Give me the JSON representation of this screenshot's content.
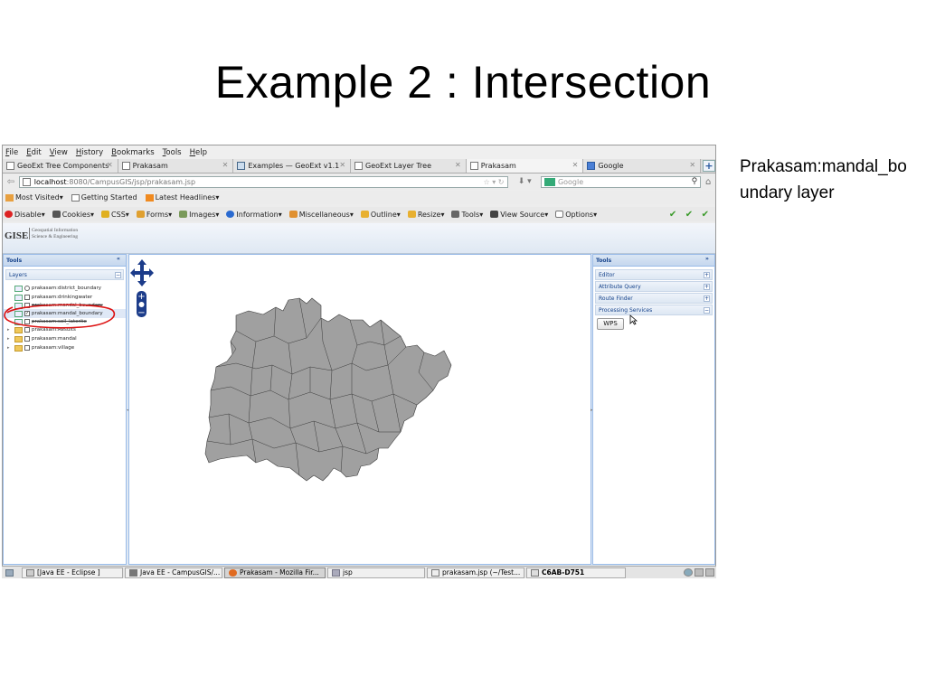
{
  "slide": {
    "title": "Example 2 : Intersection",
    "caption": "Prakasam:mandal_boundary layer"
  },
  "browser": {
    "menu": [
      "File",
      "Edit",
      "View",
      "History",
      "Bookmarks",
      "Tools",
      "Help"
    ],
    "tabs": [
      {
        "label": "GeoExt Tree Components"
      },
      {
        "label": "Prakasam"
      },
      {
        "label": "Examples — GeoExt v1.1"
      },
      {
        "label": "GeoExt Layer Tree"
      },
      {
        "label": "Prakasam"
      },
      {
        "label": "Google"
      }
    ],
    "url": {
      "host": "localhost",
      "path": ":8080/CampusGIS/jsp/prakasam.jsp"
    },
    "search_placeholder": "Google",
    "bookmarks": [
      "Most Visited",
      "Getting Started",
      "Latest Headlines"
    ],
    "devtools": [
      "Disable",
      "Cookies",
      "CSS",
      "Forms",
      "Images",
      "Information",
      "Miscellaneous",
      "Outline",
      "Resize",
      "Tools",
      "View Source",
      "Options"
    ],
    "checks": "✔ ✔ ✔"
  },
  "app": {
    "logo": "GISE",
    "logo_sub_1": "Geospatial Information",
    "logo_sub_2": "Science & Engineering",
    "left_panel": {
      "title": "Tools",
      "layers_title": "Layers",
      "layers": [
        {
          "label": "prakasam:district_boundary"
        },
        {
          "label": "prakasam:drinkingwater"
        },
        {
          "label": "prakasam:mandal_boundary"
        },
        {
          "label": "prakasam:mandal_boundary"
        },
        {
          "label": "prakasam:soil_laterite"
        }
      ],
      "folders": [
        {
          "label": "prakasam:Results"
        },
        {
          "label": "prakasam:mandal"
        },
        {
          "label": "prakasam:village"
        }
      ]
    },
    "right_panel": {
      "title": "Tools",
      "sections": [
        "Editor",
        "Attribute Query",
        "Route Finder",
        "Processing Services"
      ],
      "wps_button": "WPS"
    }
  },
  "taskbar": {
    "items": [
      {
        "label": "[Java EE - Eclipse ]"
      },
      {
        "label": "Java EE - CampusGIS/..."
      },
      {
        "label": "Prakasam - Mozilla Fir..."
      },
      {
        "label": "jsp"
      },
      {
        "label": "prakasam.jsp (~/Test..."
      },
      {
        "label": "C6AB-D751"
      }
    ]
  },
  "colors": {
    "map_fill": "#a0a0a0",
    "panel_border": "#99bbe8",
    "annotation": "#dd1111",
    "zoom_nav": "#1c3c8a"
  }
}
